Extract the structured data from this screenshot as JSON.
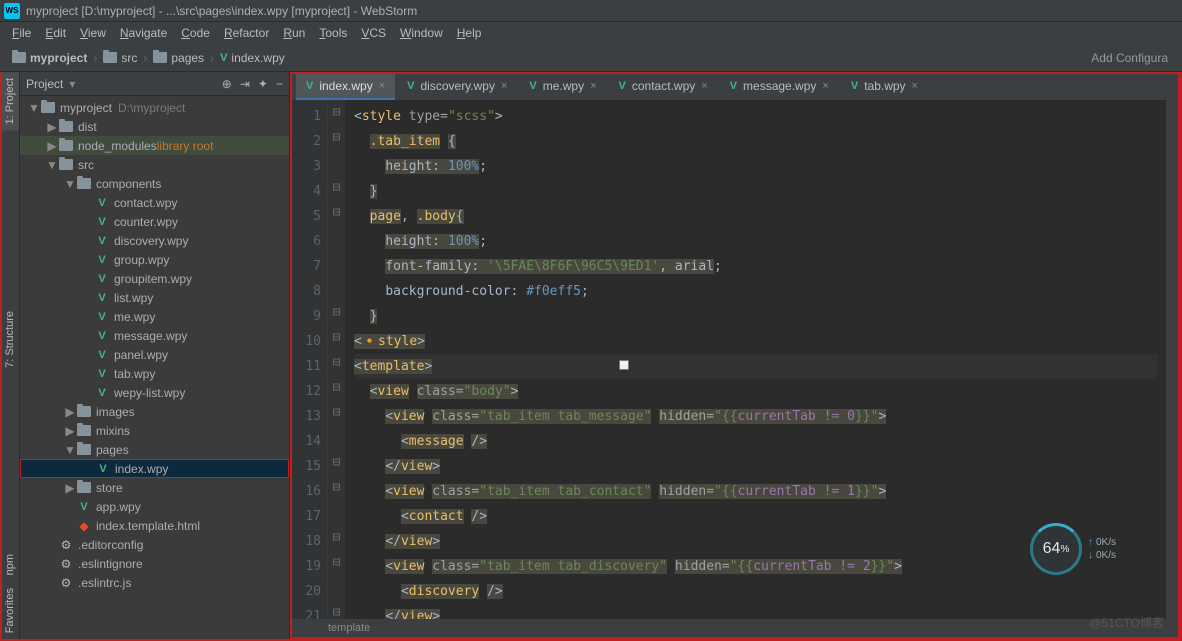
{
  "titlebar": "myproject [D:\\myproject] - ...\\src\\pages\\index.wpy [myproject] - WebStorm",
  "menu": [
    "File",
    "Edit",
    "View",
    "Navigate",
    "Code",
    "Refactor",
    "Run",
    "Tools",
    "VCS",
    "Window",
    "Help"
  ],
  "breadcrumbs": {
    "items": [
      "myproject",
      "src",
      "pages",
      "index.wpy"
    ],
    "rightAction": "Add Configura"
  },
  "panel": {
    "title": "Project",
    "rootName": "myproject",
    "rootPath": "D:\\myproject"
  },
  "tree": [
    {
      "d": 0,
      "tw": "▼",
      "ic": "folder",
      "name": "myproject",
      "extra": "D:\\myproject",
      "extraClass": "muted"
    },
    {
      "d": 1,
      "tw": "▶",
      "ic": "folder",
      "name": "dist"
    },
    {
      "d": 1,
      "tw": "▶",
      "ic": "folder",
      "name": "node_modules",
      "extra": "library root",
      "extraClass": "lib",
      "rowClass": "mod-root"
    },
    {
      "d": 1,
      "tw": "▼",
      "ic": "folder",
      "name": "src"
    },
    {
      "d": 2,
      "tw": "▼",
      "ic": "folder",
      "name": "components"
    },
    {
      "d": 3,
      "tw": "",
      "ic": "vue",
      "name": "contact.wpy"
    },
    {
      "d": 3,
      "tw": "",
      "ic": "vue",
      "name": "counter.wpy"
    },
    {
      "d": 3,
      "tw": "",
      "ic": "vue",
      "name": "discovery.wpy"
    },
    {
      "d": 3,
      "tw": "",
      "ic": "vue",
      "name": "group.wpy"
    },
    {
      "d": 3,
      "tw": "",
      "ic": "vue",
      "name": "groupitem.wpy"
    },
    {
      "d": 3,
      "tw": "",
      "ic": "vue",
      "name": "list.wpy"
    },
    {
      "d": 3,
      "tw": "",
      "ic": "vue",
      "name": "me.wpy"
    },
    {
      "d": 3,
      "tw": "",
      "ic": "vue",
      "name": "message.wpy"
    },
    {
      "d": 3,
      "tw": "",
      "ic": "vue",
      "name": "panel.wpy"
    },
    {
      "d": 3,
      "tw": "",
      "ic": "vue",
      "name": "tab.wpy"
    },
    {
      "d": 3,
      "tw": "",
      "ic": "vue",
      "name": "wepy-list.wpy"
    },
    {
      "d": 2,
      "tw": "▶",
      "ic": "folder",
      "name": "images"
    },
    {
      "d": 2,
      "tw": "▶",
      "ic": "folder",
      "name": "mixins"
    },
    {
      "d": 2,
      "tw": "▼",
      "ic": "folder",
      "name": "pages"
    },
    {
      "d": 3,
      "tw": "",
      "ic": "vue",
      "name": "index.wpy",
      "rowClass": "selected highlight"
    },
    {
      "d": 2,
      "tw": "▶",
      "ic": "folder",
      "name": "store"
    },
    {
      "d": 2,
      "tw": "",
      "ic": "vue",
      "name": "app.wpy"
    },
    {
      "d": 2,
      "tw": "",
      "ic": "html",
      "name": "index.template.html"
    },
    {
      "d": 1,
      "tw": "",
      "ic": "gear",
      "name": ".editorconfig"
    },
    {
      "d": 1,
      "tw": "",
      "ic": "gear",
      "name": ".eslintignore"
    },
    {
      "d": 1,
      "tw": "",
      "ic": "gear",
      "name": ".eslintrc.js"
    }
  ],
  "tabs": [
    "index.wpy",
    "discovery.wpy",
    "me.wpy",
    "contact.wpy",
    "message.wpy",
    "tab.wpy"
  ],
  "activeTab": 0,
  "lineCount": 21,
  "caretLine": 11,
  "crumbBottom": "template",
  "perf": {
    "pct": "64",
    "up": "0K/s",
    "dn": "0K/s"
  },
  "watermark": "@51CTO博客",
  "leftGutter": [
    "1: Project",
    "7: Structure",
    "npm",
    "Favorites"
  ],
  "code": {
    "l1": {
      "pre": "",
      "a": "<style type=",
      "b": "\"scss\"",
      "c": ">"
    },
    "l2": {
      "pre": "  ",
      "a": ".tab_item {"
    },
    "l3": {
      "pre": "    ",
      "a": "height: ",
      "b": "100%",
      "c": ";"
    },
    "l4": {
      "pre": "  ",
      "a": "}"
    },
    "l5": {
      "pre": "  ",
      "a": "page",
      "b": ", ",
      "c": ".body",
      "d": "{"
    },
    "l6": {
      "pre": "    ",
      "a": "height: ",
      "b": "100%",
      "c": ";"
    },
    "l7": {
      "pre": "    ",
      "a": "font-family: ",
      "b": "'\\5FAE\\8F6F\\96C5\\9ED1'",
      "c": ", arial",
      "d": ";"
    },
    "l8": {
      "pre": "    ",
      "a": "background-color: ",
      "b": "#f0eff5",
      "c": ";"
    },
    "l9": {
      "pre": "  ",
      "a": "}"
    },
    "l10": {
      "pre": "",
      "a": "<",
      "b": "/",
      "c": "style",
      "d": ">"
    },
    "l11": {
      "pre": "",
      "a": "<",
      "b": "template",
      "c": ">"
    },
    "l12": {
      "pre": "  ",
      "a": "<",
      "b": "view",
      "c": " class=",
      "d": "\"body\"",
      "e": ">"
    },
    "l13": {
      "pre": "    ",
      "a": "<",
      "b": "view",
      "c": " class=",
      "d": "\"tab_item tab_message\"",
      "e": " hidden=",
      "f": "\"{{",
      "g": "currentTab != 0",
      "h": "}}\"",
      "i": ">"
    },
    "l14": {
      "pre": "      ",
      "a": "<",
      "b": "message",
      "c": " />"
    },
    "l15": {
      "pre": "    ",
      "a": "</",
      "b": "view",
      "c": ">"
    },
    "l16": {
      "pre": "    ",
      "a": "<",
      "b": "view",
      "c": " class=",
      "d": "\"tab_item tab_contact\"",
      "e": " hidden=",
      "f": "\"{{",
      "g": "currentTab != 1",
      "h": "}}\"",
      "i": ">"
    },
    "l17": {
      "pre": "      ",
      "a": "<",
      "b": "contact",
      "c": " />"
    },
    "l18": {
      "pre": "    ",
      "a": "</",
      "b": "view",
      "c": ">"
    },
    "l19": {
      "pre": "    ",
      "a": "<",
      "b": "view",
      "c": " class=",
      "d": "\"tab_item tab_discovery\"",
      "e": " hidden=",
      "f": "\"{{",
      "g": "currentTab != 2",
      "h": "}}\"",
      "i": ">"
    },
    "l20": {
      "pre": "      ",
      "a": "<",
      "b": "discovery",
      "c": " />"
    },
    "l21": {
      "pre": "    ",
      "a": "</",
      "b": "view",
      "c": ">"
    }
  }
}
